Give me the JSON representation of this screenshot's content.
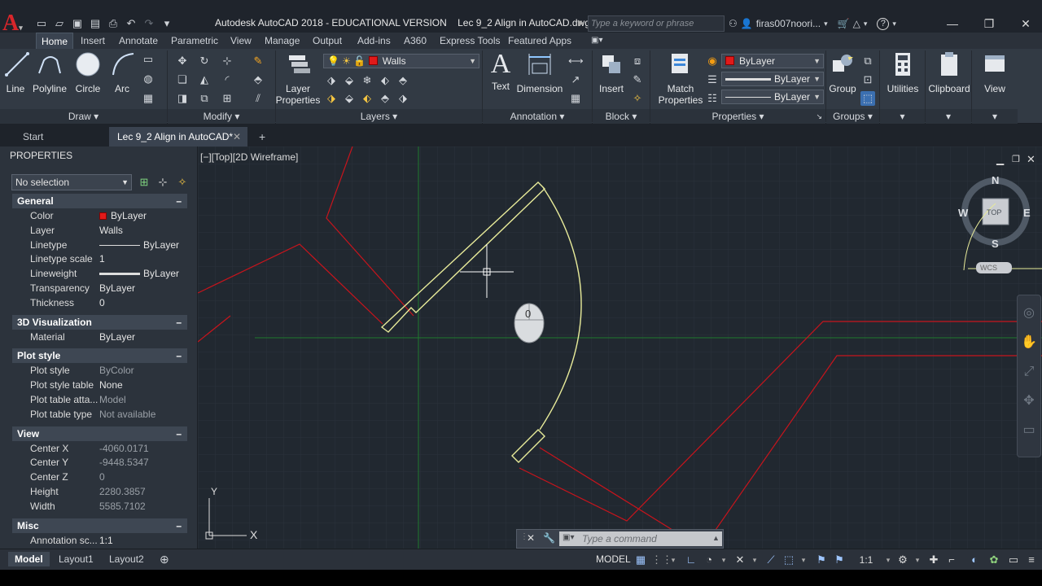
{
  "window": {
    "title": "Autodesk AutoCAD 2018 - EDUCATIONAL VERSION    Lec 9_2 Align in AutoCAD.dwg",
    "search_placeholder": "Type a keyword or phrase",
    "user": "firas007noori...",
    "help": "?"
  },
  "ribbon_tabs": [
    "Home",
    "Insert",
    "Annotate",
    "Parametric",
    "View",
    "Manage",
    "Output",
    "Add-ins",
    "A360",
    "Express Tools",
    "Featured Apps"
  ],
  "draw_panel": {
    "title": "Draw",
    "line": "Line",
    "polyline": "Polyline",
    "circle": "Circle",
    "arc": "Arc"
  },
  "modify_panel": {
    "title": "Modify"
  },
  "layers_panel": {
    "title": "Layers",
    "layer_properties": "Layer Properties",
    "current_layer": "Walls"
  },
  "annotation_panel": {
    "title": "Annotation",
    "text": "Text",
    "dimension": "Dimension"
  },
  "block_panel": {
    "title": "Block",
    "insert": "Insert"
  },
  "properties_panel": {
    "title": "Properties",
    "match": "Match Properties",
    "color": "ByLayer",
    "linetype": "ByLayer",
    "lineweight": "ByLayer"
  },
  "groups_panel": {
    "title": "Groups",
    "group": "Group"
  },
  "utilities": "Utilities",
  "clipboard": "Clipboard",
  "view_btn": "View",
  "file_tabs": {
    "start": "Start",
    "active": "Lec 9_2 Align in AutoCAD*",
    "new": "+"
  },
  "palette": {
    "title": "PROPERTIES",
    "selection": "No selection",
    "sections": {
      "general": {
        "label": "General",
        "rows": [
          {
            "k": "Color",
            "v": "ByLayer"
          },
          {
            "k": "Layer",
            "v": "Walls"
          },
          {
            "k": "Linetype",
            "v": "ByLayer"
          },
          {
            "k": "Linetype scale",
            "v": "1"
          },
          {
            "k": "Lineweight",
            "v": "ByLayer"
          },
          {
            "k": "Transparency",
            "v": "ByLayer"
          },
          {
            "k": "Thickness",
            "v": "0"
          }
        ]
      },
      "visualization": {
        "label": "3D Visualization",
        "rows": [
          {
            "k": "Material",
            "v": "ByLayer"
          }
        ]
      },
      "plot": {
        "label": "Plot style",
        "rows": [
          {
            "k": "Plot style",
            "v": "ByColor"
          },
          {
            "k": "Plot style table",
            "v": "None"
          },
          {
            "k": "Plot table atta...",
            "v": "Model"
          },
          {
            "k": "Plot table type",
            "v": "Not available"
          }
        ]
      },
      "view": {
        "label": "View",
        "rows": [
          {
            "k": "Center X",
            "v": "-4060.0171"
          },
          {
            "k": "Center Y",
            "v": "-9448.5347"
          },
          {
            "k": "Center Z",
            "v": "0"
          },
          {
            "k": "Height",
            "v": "2280.3857"
          },
          {
            "k": "Width",
            "v": "5585.7102"
          }
        ]
      },
      "misc": {
        "label": "Misc",
        "rows": [
          {
            "k": "Annotation sc...",
            "v": "1:1"
          }
        ]
      }
    }
  },
  "viewport": {
    "label": "[−][Top][2D Wireframe]",
    "compass": {
      "n": "N",
      "s": "S",
      "e": "E",
      "w": "W",
      "top": "TOP",
      "wcs": "WCS"
    },
    "ucs": {
      "x": "X",
      "y": "Y"
    },
    "mouse_indicator": "0"
  },
  "command_line": {
    "placeholder": "Type a command"
  },
  "layout_tabs": [
    "Model",
    "Layout1",
    "Layout2"
  ],
  "status_bar": {
    "model": "MODEL",
    "scale": "1:1"
  },
  "colors": {
    "accent_red": "#e01a1a",
    "selection_yellow": "#e8eb9a",
    "canvas": "#212830"
  }
}
